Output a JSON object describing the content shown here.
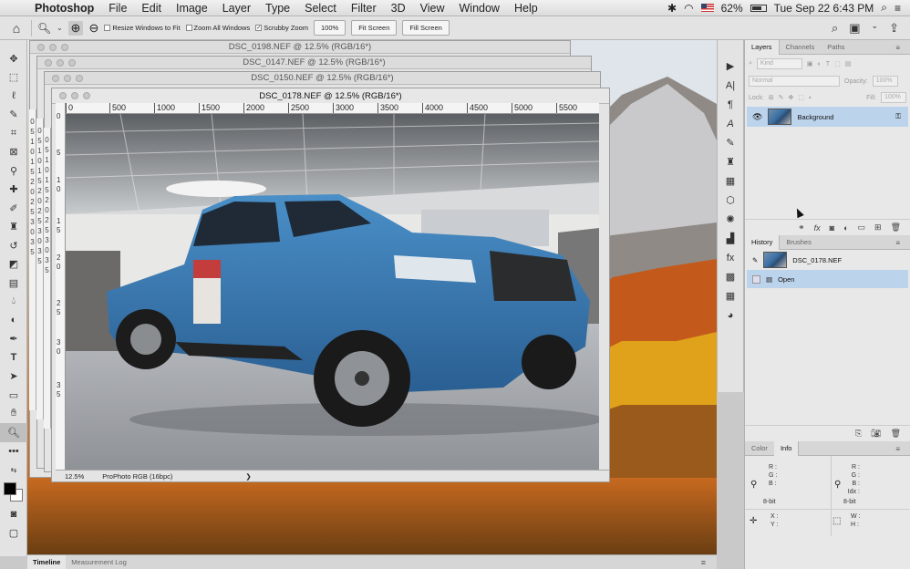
{
  "menubar": {
    "app_name": "Photoshop",
    "items": [
      "File",
      "Edit",
      "Image",
      "Layer",
      "Type",
      "Select",
      "Filter",
      "3D",
      "View",
      "Window",
      "Help"
    ],
    "battery": "62%",
    "datetime": "Tue Sep 22  6:43 PM"
  },
  "options": {
    "resize_windows": "Resize Windows to Fit",
    "zoom_all": "Zoom All Windows",
    "scrubby_zoom": "Scrubby Zoom",
    "zoom_value": "100%",
    "fit_screen": "Fit Screen",
    "fill_screen": "Fill Screen"
  },
  "documents": {
    "doc1_title": "DSC_0198.NEF @ 12.5% (RGB/16*)",
    "doc2_title": "DSC_0147.NEF @ 12.5% (RGB/16*)",
    "doc3_title": "DSC_0150.NEF @ 12.5% (RGB/16*)",
    "main_title": "DSC_0178.NEF @ 12.5% (RGB/16*)"
  },
  "ruler_top": [
    "0",
    "500",
    "1000",
    "1500",
    "2000",
    "2500",
    "3000",
    "3500",
    "4000",
    "4500",
    "5000",
    "5500"
  ],
  "ruler_left": [
    "0",
    "5",
    "1",
    "0",
    "1",
    "5",
    "2",
    "0",
    "2",
    "5",
    "3",
    "0",
    "3",
    "5"
  ],
  "status": {
    "zoom": "12.5%",
    "profile": "ProPhoto RGB (16bpc)",
    "arrow": "❯"
  },
  "layers_panel": {
    "tabs": [
      "Layers",
      "Channels",
      "Paths"
    ],
    "kind": "Kind",
    "blend": "Normal",
    "opacity_label": "Opacity:",
    "opacity_value": "100%",
    "lock_label": "Lock:",
    "fill_label": "Fill:",
    "fill_value": "100%",
    "layer_name": "Background"
  },
  "history_panel": {
    "tabs": [
      "History",
      "Brushes"
    ],
    "snapshot": "DSC_0178.NEF",
    "step": "Open"
  },
  "info_panel": {
    "tabs": [
      "Color",
      "Info"
    ],
    "rgb_left": "R :\nG :\nB :",
    "rgb_right": "R :\nG :\nB :\nIdx :",
    "bit_left": "8-bit",
    "bit_right": "8-bit",
    "xy": "X :\nY :",
    "wh": "W :\nH :"
  },
  "timeline": {
    "tabs": [
      "Timeline",
      "Measurement Log"
    ]
  },
  "icons": {
    "apple": "",
    "home": "⌂",
    "zoom_in": "⊕",
    "zoom_out": "⊖",
    "search": "⌕",
    "eye": "◉",
    "lock": "🔒",
    "menu": "≡"
  }
}
